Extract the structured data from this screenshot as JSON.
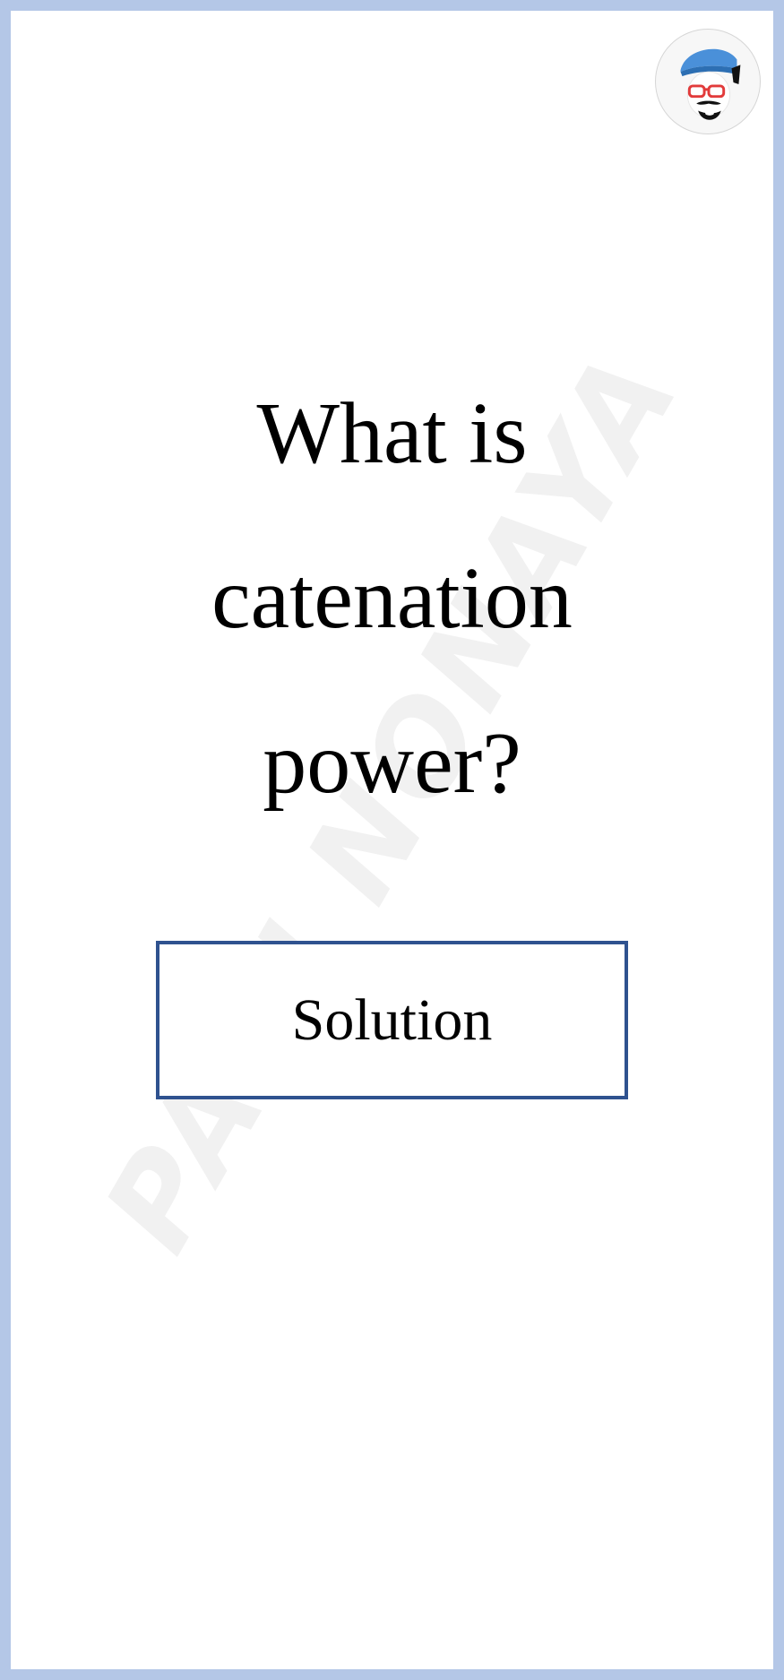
{
  "watermark": {
    "text": "PANJ NONAYA",
    "color": "#f1f1f1"
  },
  "avatar": {
    "icon": "cartoon-face-with-cap-and-glasses-icon"
  },
  "question": {
    "text": "What is catenation power?"
  },
  "solution_button": {
    "label": "Solution",
    "border_color": "#2f528f"
  },
  "theme": {
    "frame_color": "#b4c7e7",
    "background": "#ffffff",
    "text_color": "#000000"
  }
}
